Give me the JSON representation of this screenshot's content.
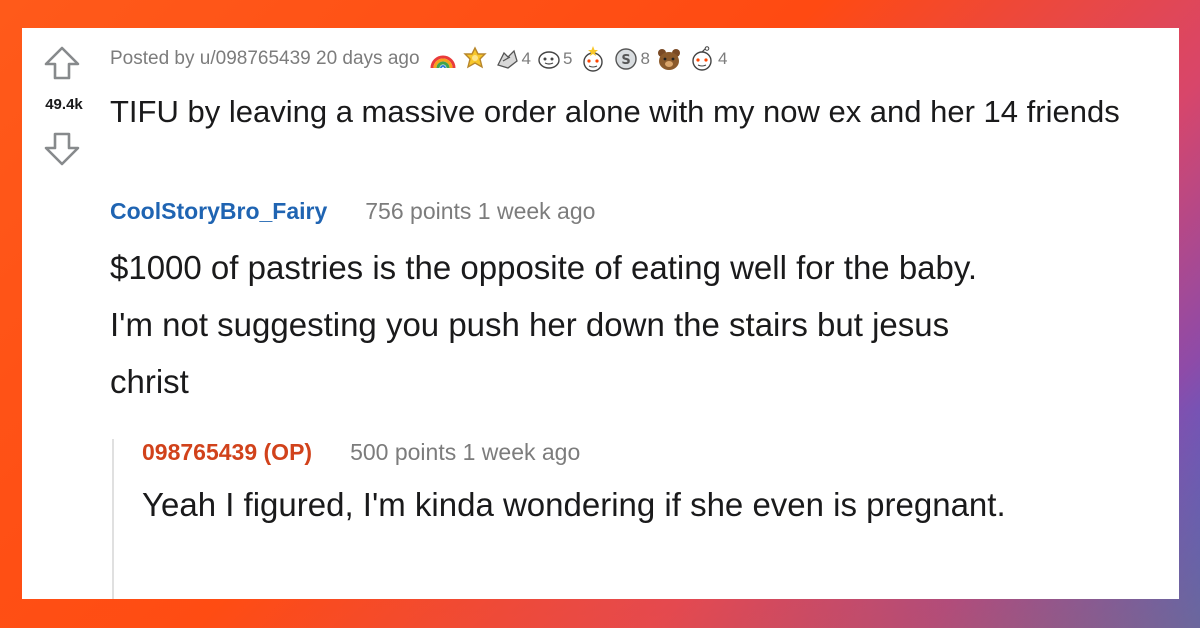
{
  "post": {
    "score": "49.4k",
    "posted_by": "Posted by u/098765439 20 days ago",
    "title": "TIFU by leaving a massive order alone with my now ex and her 14 friends",
    "awards": [
      {
        "icon": "rainbow-award-icon",
        "count": ""
      },
      {
        "icon": "gold-badge-award-icon",
        "count": ""
      },
      {
        "icon": "hands-award-icon",
        "count": "4"
      },
      {
        "icon": "face-award-icon",
        "count": "5"
      },
      {
        "icon": "snoo-star-award-icon",
        "count": ""
      },
      {
        "icon": "silver-award-icon",
        "count": "8"
      },
      {
        "icon": "bear-award-icon",
        "count": ""
      },
      {
        "icon": "snoo-award-icon",
        "count": "4"
      }
    ]
  },
  "comments": [
    {
      "user": "CoolStoryBro_Fairy",
      "meta": "756 points 1 week ago",
      "body": "$1000 of pastries is the opposite of eating well for the baby. I'm not suggesting you push her down the stairs but jesus christ"
    },
    {
      "user": "098765439 (OP)",
      "meta": "500 points 1 week ago",
      "body": "Yeah I figured, I'm kinda wondering if she even is pregnant."
    }
  ],
  "colors": {
    "username_blue": "#1f64b2",
    "op_orange": "#d1421b",
    "meta_gray": "#7c7c7c",
    "text_dark": "#1a1a1b"
  }
}
